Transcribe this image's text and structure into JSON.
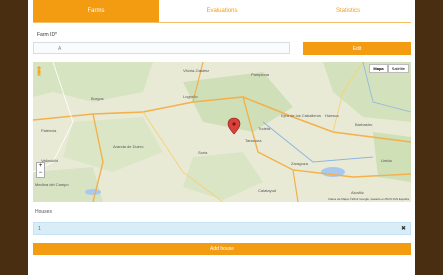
{
  "tabs": [
    {
      "label": "Farms",
      "active": true
    },
    {
      "label": "Evaluations",
      "active": false
    },
    {
      "label": "Statistics",
      "active": false
    }
  ],
  "farm": {
    "label": "Farm ID*",
    "value": "A",
    "edit_label": "Edit"
  },
  "map": {
    "type_map": "Mapa",
    "type_satellite": "Satélite",
    "zoom_in": "+",
    "zoom_out": "−",
    "attribution": "Datos de Mapa ©2014 Google, basado en BCN IGN España",
    "places": [
      {
        "name": "Burgos"
      },
      {
        "name": "Logroño"
      },
      {
        "name": "Pamplona"
      },
      {
        "name": "Vitoria-Gasteiz"
      },
      {
        "name": "Valladolid"
      },
      {
        "name": "Soria"
      },
      {
        "name": "Tarazona"
      },
      {
        "name": "Zaragoza"
      },
      {
        "name": "Huesca"
      },
      {
        "name": "Lleida"
      },
      {
        "name": "Calatayud"
      },
      {
        "name": "Aranda de Duero"
      },
      {
        "name": "Palencia"
      },
      {
        "name": "Tudela"
      },
      {
        "name": "Ejea de los Caballeros"
      },
      {
        "name": "Barbastro"
      },
      {
        "name": "Alcañiz"
      },
      {
        "name": "Medina del Campo"
      }
    ]
  },
  "houses": {
    "label": "Houses",
    "items": [
      {
        "id": "1"
      }
    ],
    "delete_icon": "✖",
    "add_label": "Add house"
  },
  "colors": {
    "accent": "#f39c12",
    "info_bg": "#d9edf7"
  }
}
